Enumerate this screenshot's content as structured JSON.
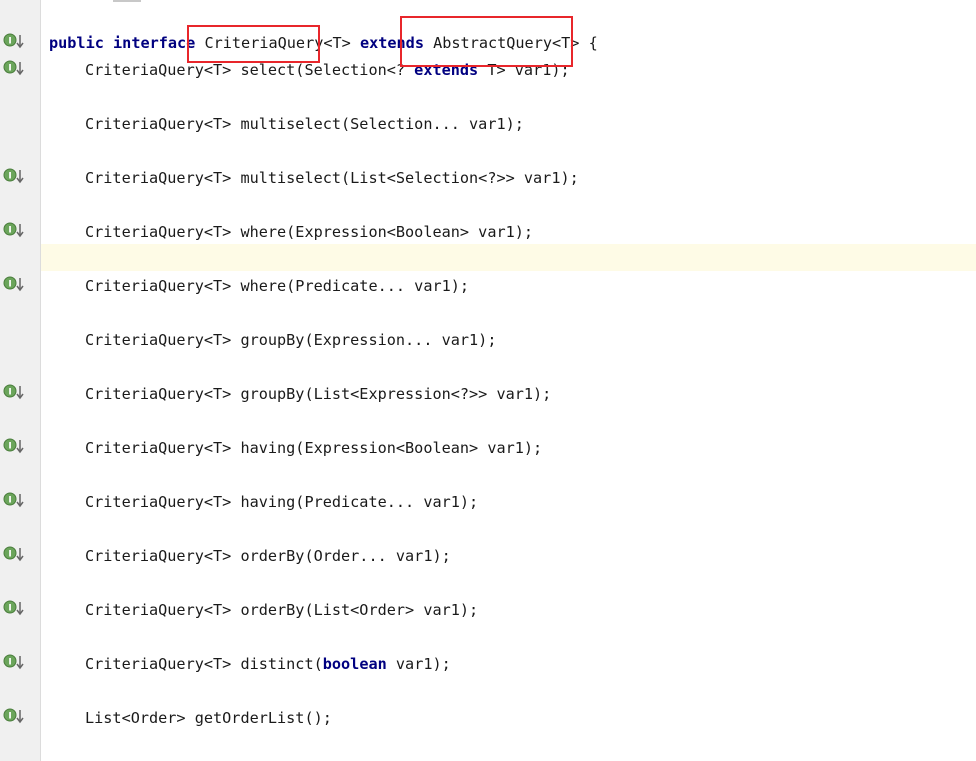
{
  "editor": {
    "header": {
      "kw_public": "public",
      "kw_interface": "interface",
      "name": "CriteriaQuery",
      "type_param": "<T>",
      "kw_extends": "extends",
      "parent": "AbstractQuery",
      "parent_type_param": "<T>",
      "open_brace": "{"
    },
    "methods": [
      {
        "pre": "CriteriaQuery<T> select(Selection<? ",
        "kw": "extends",
        "post": " T> var1);"
      },
      {
        "pre": "CriteriaQuery<T> multiselect(Selection... var1);",
        "kw": "",
        "post": ""
      },
      {
        "pre": "CriteriaQuery<T> multiselect(List<Selection<?>> var1);",
        "kw": "",
        "post": ""
      },
      {
        "pre": "CriteriaQuery<T> where(Expression<Boolean> var1);",
        "kw": "",
        "post": ""
      },
      {
        "pre": "CriteriaQuery<T> where(Predicate... var1);",
        "kw": "",
        "post": ""
      },
      {
        "pre": "CriteriaQuery<T> groupBy(Expression... var1);",
        "kw": "",
        "post": ""
      },
      {
        "pre": "CriteriaQuery<T> groupBy(List<Expression<?>> var1);",
        "kw": "",
        "post": ""
      },
      {
        "pre": "CriteriaQuery<T> having(Expression<Boolean> var1);",
        "kw": "",
        "post": ""
      },
      {
        "pre": "CriteriaQuery<T> having(Predicate... var1);",
        "kw": "",
        "post": ""
      },
      {
        "pre": "CriteriaQuery<T> orderBy(Order... var1);",
        "kw": "",
        "post": ""
      },
      {
        "pre": "CriteriaQuery<T> orderBy(List<Order> var1);",
        "kw": "",
        "post": ""
      },
      {
        "pre": "CriteriaQuery<T> distinct(",
        "kw": "boolean",
        "post": " var1);"
      },
      {
        "pre": "List<Order> getOrderList();",
        "kw": "",
        "post": ""
      }
    ],
    "gutter_icon": "implemented-method-icon",
    "gutter_icon_letter": "I",
    "colors": {
      "keyword": "#000080",
      "highlight_box": "#e8262b",
      "caret_line": "#fefbe6",
      "gutter_icon": "#6ba55b"
    }
  }
}
